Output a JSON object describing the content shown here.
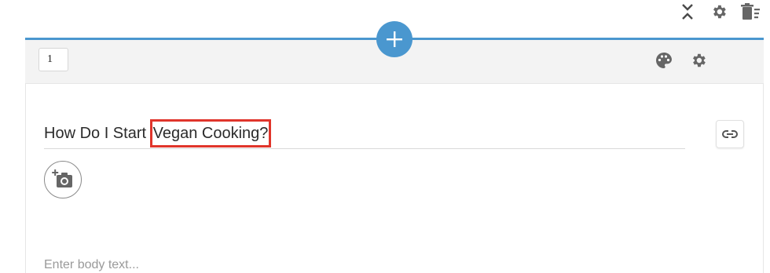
{
  "top_icons": [
    "collapse-expand-icon",
    "gear-icon",
    "trash-menu-icon"
  ],
  "block": {
    "order_value": "1",
    "toolbar_icons": [
      "palette-icon",
      "gear-icon"
    ],
    "title_prefix": "How Do I Start ",
    "title_highlight": "Vegan Cooking?",
    "body_placeholder": "Enter body text...",
    "colors": {
      "accent": "#4a97cf",
      "highlight_border": "#e0352b",
      "toolbar_bg": "#f3f3f3",
      "icon": "#666666"
    }
  }
}
